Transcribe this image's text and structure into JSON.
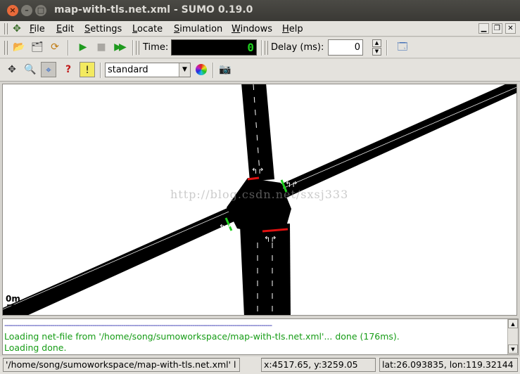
{
  "window": {
    "title": "map-with-tls.net.xml - SUMO 0.19.0",
    "close_glyph": "×",
    "minimize_glyph": "–",
    "maximize_glyph": "□"
  },
  "menu": {
    "items": [
      {
        "label": "File",
        "mnemonic": "F"
      },
      {
        "label": "Edit",
        "mnemonic": "E"
      },
      {
        "label": "Settings",
        "mnemonic": "S"
      },
      {
        "label": "Locate",
        "mnemonic": "L"
      },
      {
        "label": "Simulation",
        "mnemonic": "S"
      },
      {
        "label": "Windows",
        "mnemonic": "W"
      },
      {
        "label": "Help",
        "mnemonic": "H"
      }
    ]
  },
  "toolbar": {
    "time_label": "Time:",
    "time_value": "0",
    "delay_label": "Delay (ms):",
    "delay_value": "0"
  },
  "view": {
    "scheme_value": "standard"
  },
  "canvas": {
    "scale_label": "0m",
    "watermark": "http://blog.csdn.net/sxsj333"
  },
  "log": {
    "separator": "--------------------------------------------------------------------------------------------------------------------------------",
    "lines": [
      "Loading net-file from '/home/song/sumoworkspace/map-with-tls.net.xml'...  done (176ms).",
      "Loading done."
    ]
  },
  "status": {
    "path": "'/home/song/sumoworkspace/map-with-tls.net.xml' l",
    "xy": "x:4517.65, y:3259.05",
    "latlon": "lat:26.093835, lon:119.32144"
  },
  "colors": {
    "road": "#000000",
    "lane_marking": "#ffffff",
    "signal_green": "#1fd11f",
    "signal_red": "#e01010",
    "log_text": "#169c16"
  }
}
